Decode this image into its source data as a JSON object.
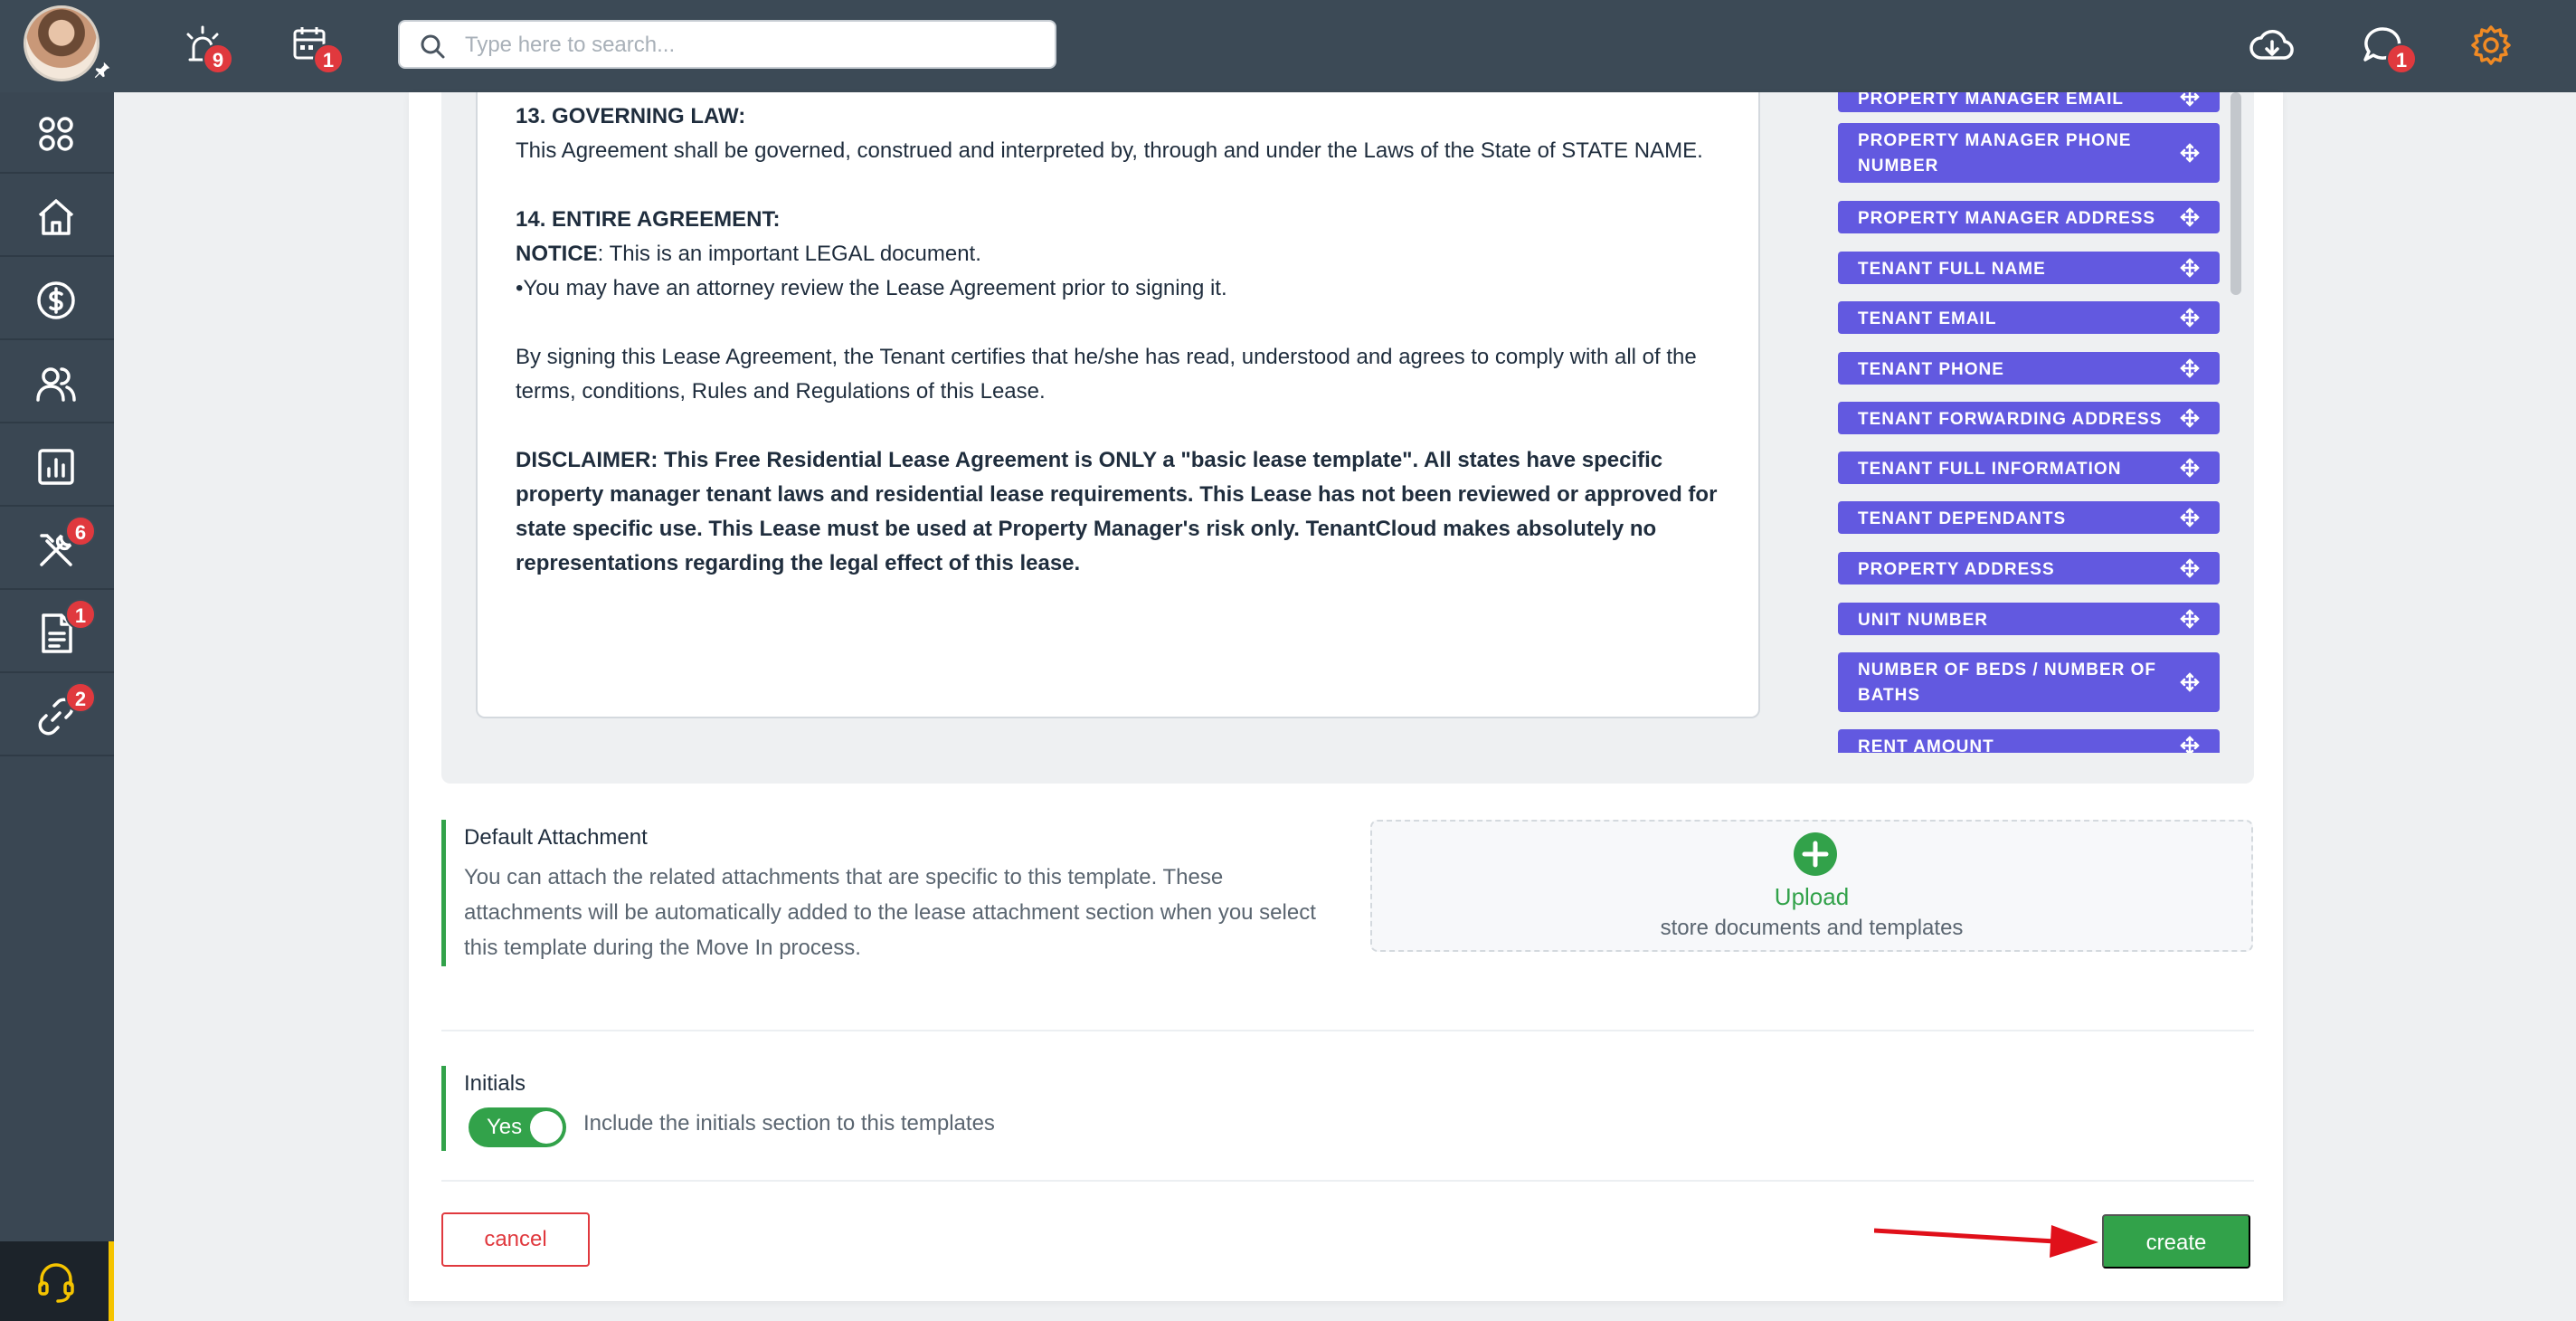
{
  "topbar": {
    "search_placeholder": "Type here to search...",
    "alerts_count": "9",
    "calendar_count": "1",
    "messages_count": "1"
  },
  "sidebar": {
    "maintenance_count": "6",
    "documents_count": "1",
    "links_count": "2"
  },
  "document": {
    "section13_title": "13. GOVERNING LAW:",
    "section13_text": "This Agreement shall be governed, construed and interpreted by, through and under the Laws of the State of STATE NAME.",
    "section14_title": "14. ENTIRE AGREEMENT:",
    "notice_label": "NOTICE",
    "notice_text": ": This is an important LEGAL document.",
    "bullet_text": "•You may have an attorney review the Lease Agreement prior to signing it.",
    "signing_text": "By signing this Lease Agreement, the Tenant certifies that he/she has read, understood and agrees to comply with all of the terms, conditions, Rules and Regulations of this Lease.",
    "disclaimer_text": "DISCLAIMER: This Free Residential Lease Agreement is ONLY a \"basic lease template\". All states have specific property manager tenant laws and residential lease requirements. This Lease has not been reviewed or approved for state specific use. This Lease must be used at Property Manager's risk only. TenantCloud makes absolutely no representations regarding the legal effect of this lease."
  },
  "fields": [
    "PROPERTY MANAGER EMAIL",
    "PROPERTY MANAGER PHONE NUMBER",
    "PROPERTY MANAGER ADDRESS",
    "TENANT FULL NAME",
    "TENANT EMAIL",
    "TENANT PHONE",
    "TENANT FORWARDING ADDRESS",
    "TENANT FULL INFORMATION",
    "TENANT DEPENDANTS",
    "PROPERTY ADDRESS",
    "UNIT NUMBER",
    "NUMBER OF BEDS / NUMBER OF BATHS",
    "RENT AMOUNT"
  ],
  "attachment": {
    "title": "Default Attachment",
    "description": "You can attach the related attachments that are specific to this template. These attachments will be automatically added to the lease attachment section when you select this template during the Move In process.",
    "upload_label": "Upload",
    "upload_sub": "store documents and templates"
  },
  "initials": {
    "title": "Initials",
    "toggle_label": "Yes",
    "toggle_on": true,
    "description": "Include the initials section to this templates"
  },
  "actions": {
    "cancel_label": "cancel",
    "create_label": "create"
  },
  "colors": {
    "field_bg": "#6259e0",
    "accent_green": "#32a24a",
    "danger": "#e0393e",
    "topbar_bg": "#3c4a56",
    "settings_orange": "#f08a24"
  }
}
